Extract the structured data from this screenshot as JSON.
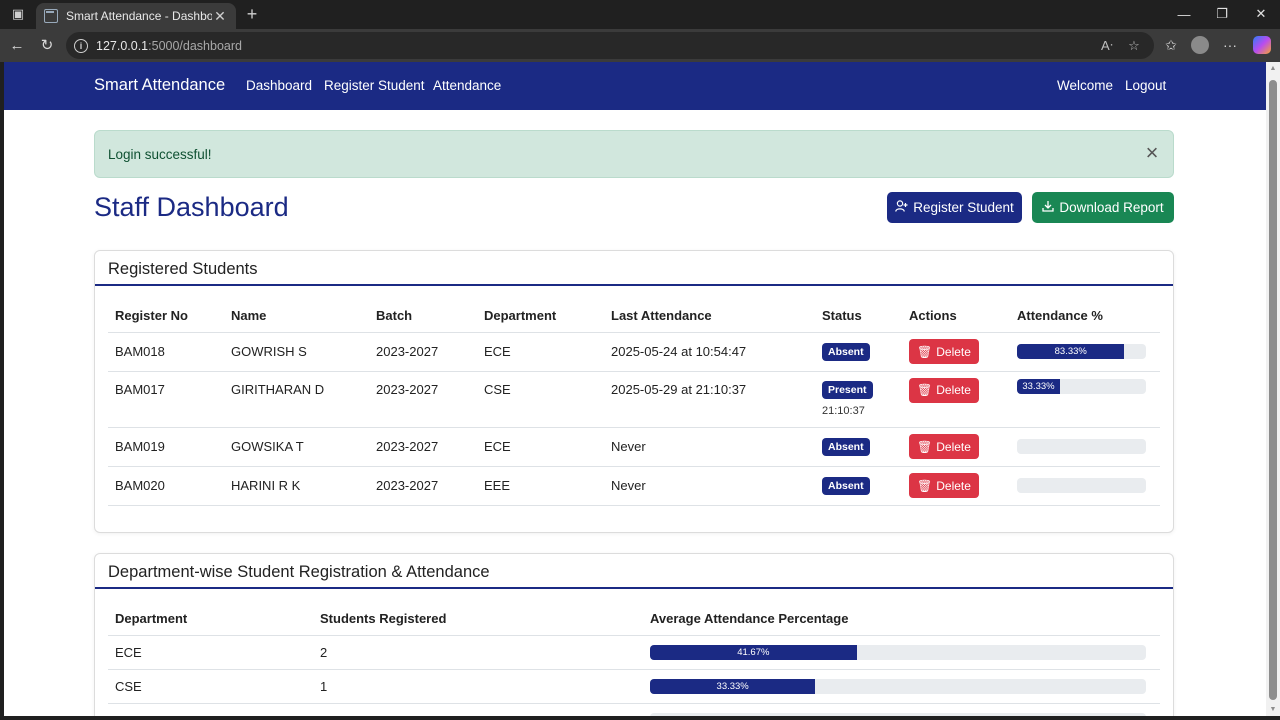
{
  "browser": {
    "tab_title": "Smart Attendance - Dashboard",
    "url_host": "127.0.0.1",
    "url_rest": ":5000/dashboard"
  },
  "navbar": {
    "brand": "Smart Attendance",
    "links": [
      "Dashboard",
      "Register Student",
      "Attendance"
    ],
    "welcome": "Welcome",
    "logout": "Logout"
  },
  "alert": {
    "message": "Login successful!"
  },
  "page": {
    "title": "Staff Dashboard",
    "register_button": "Register Student",
    "download_button": "Download Report"
  },
  "students": {
    "header": "Registered Students",
    "columns": [
      "Register No",
      "Name",
      "Batch",
      "Department",
      "Last Attendance",
      "Status",
      "Actions",
      "Attendance %"
    ],
    "rows": [
      {
        "reg": "BAM018",
        "name": "GOWRISH S",
        "batch": "2023-2027",
        "dept": "ECE",
        "last": "2025-05-24 at 10:54:47",
        "status": "Absent",
        "status_time": "",
        "delete": "Delete",
        "pct": 83.33,
        "pct_label": "83.33%"
      },
      {
        "reg": "BAM017",
        "name": "GIRITHARAN D",
        "batch": "2023-2027",
        "dept": "CSE",
        "last": "2025-05-29 at 21:10:37",
        "status": "Present",
        "status_time": "21:10:37",
        "delete": "Delete",
        "pct": 33.33,
        "pct_label": "33.33%"
      },
      {
        "reg": "BAM019",
        "name": "GOWSIKA T",
        "batch": "2023-2027",
        "dept": "ECE",
        "last": "Never",
        "status": "Absent",
        "status_time": "",
        "delete": "Delete",
        "pct": 0,
        "pct_label": ""
      },
      {
        "reg": "BAM020",
        "name": "HARINI R K",
        "batch": "2023-2027",
        "dept": "EEE",
        "last": "Never",
        "status": "Absent",
        "status_time": "",
        "delete": "Delete",
        "pct": 0,
        "pct_label": ""
      }
    ]
  },
  "departments": {
    "header": "Department-wise Student Registration & Attendance",
    "columns": [
      "Department",
      "Students Registered",
      "Average Attendance Percentage"
    ],
    "rows": [
      {
        "dept": "ECE",
        "count": "2",
        "pct": 41.67,
        "pct_label": "41.67%"
      },
      {
        "dept": "CSE",
        "count": "1",
        "pct": 33.33,
        "pct_label": "33.33%"
      }
    ]
  },
  "colors": {
    "primary": "#1b2a84",
    "success": "#198754",
    "danger": "#dc3545",
    "alert_bg": "#d1e7dd"
  }
}
